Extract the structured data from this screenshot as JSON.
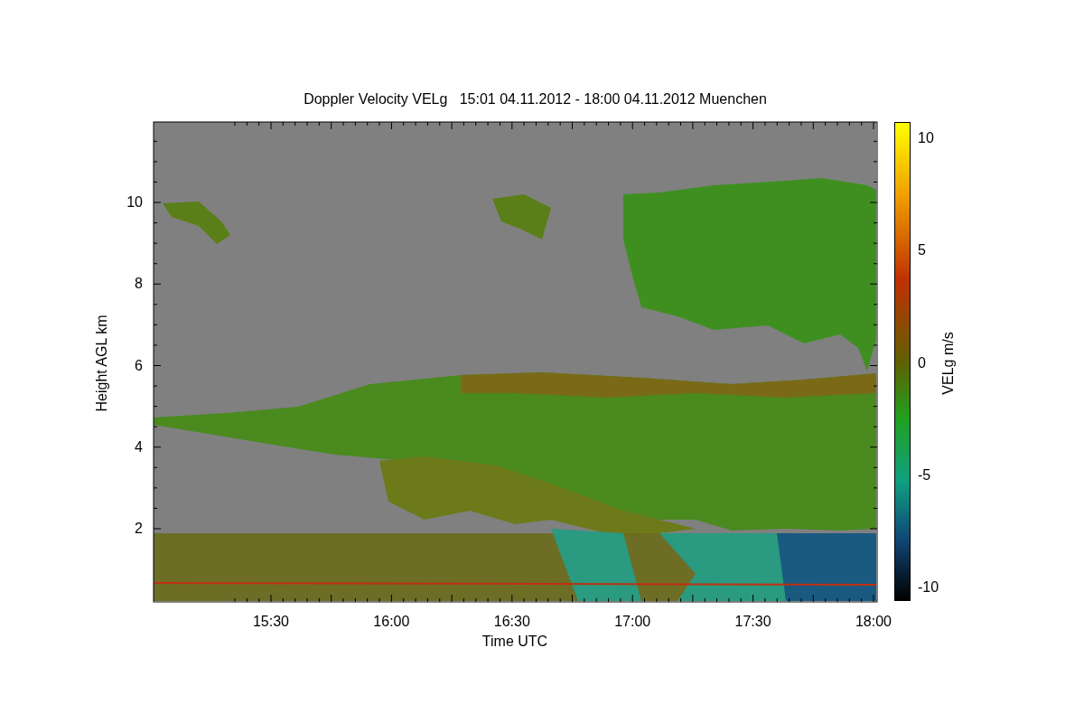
{
  "title": "Doppler Velocity VELg   15:01 04.11.2012 - 18:00 04.11.2012 Muenchen",
  "y_axis": {
    "label": "Height AGL km",
    "ticks": [
      "10",
      "8",
      "6",
      "4",
      "2"
    ]
  },
  "x_axis": {
    "label": "Time UTC",
    "ticks": [
      "15:30",
      "16:00",
      "16:30",
      "17:00",
      "17:30",
      "18:00"
    ]
  },
  "colorbar": {
    "label": "VELg m/s",
    "ticks": [
      "10",
      "5",
      "0",
      "-5",
      "-10"
    ]
  }
}
